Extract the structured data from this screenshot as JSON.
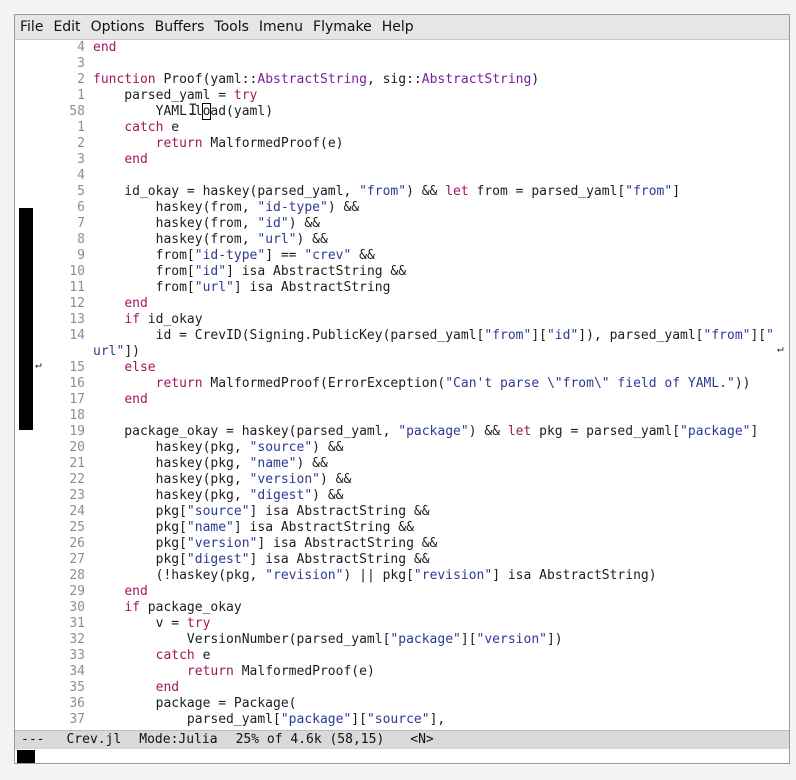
{
  "menu": [
    "File",
    "Edit",
    "Options",
    "Buffers",
    "Tools",
    "Imenu",
    "Flymake",
    "Help"
  ],
  "modeline": {
    "status": "---",
    "buffer": "Crev.jl",
    "mode": "Mode:Julia",
    "position": "25% of 4.6k (58,15)",
    "state": "<N>"
  },
  "icons": {
    "wrap_left": "wrap-left-arrow-icon",
    "wrap_right": "wrap-right-arrow-icon",
    "ibeam": "ibeam-cursor-icon"
  },
  "lines": [
    {
      "n": "4",
      "t": [
        [
          "end",
          "kw"
        ]
      ]
    },
    {
      "n": "3",
      "t": []
    },
    {
      "n": "2",
      "t": [
        [
          "function",
          "kw"
        ],
        [
          " Proof(yaml::",
          ""
        ],
        [
          "AbstractString",
          "ty"
        ],
        [
          ", sig::",
          ""
        ],
        [
          "AbstractString",
          "ty"
        ],
        [
          ")",
          ""
        ]
      ]
    },
    {
      "n": "1",
      "t": [
        [
          "    parsed_yaml = ",
          ""
        ],
        [
          "try",
          "kw"
        ]
      ]
    },
    {
      "n": "58",
      "t": [
        [
          "        YAML.l",
          ""
        ],
        [
          "o",
          "cur"
        ],
        [
          "ad(yaml)",
          ""
        ]
      ]
    },
    {
      "n": "1",
      "t": [
        [
          "    ",
          ""
        ],
        [
          "catch",
          "kw"
        ],
        [
          " e",
          ""
        ]
      ]
    },
    {
      "n": "2",
      "t": [
        [
          "        ",
          ""
        ],
        [
          "return",
          "kw"
        ],
        [
          " MalformedProof(e)",
          ""
        ]
      ]
    },
    {
      "n": "3",
      "t": [
        [
          "    ",
          ""
        ],
        [
          "end",
          "kw"
        ]
      ]
    },
    {
      "n": "4",
      "t": []
    },
    {
      "n": "5",
      "t": [
        [
          "    id_okay = haskey(parsed_yaml, ",
          ""
        ],
        [
          "\"from\"",
          "st"
        ],
        [
          ") && ",
          ""
        ],
        [
          "let",
          "kw"
        ],
        [
          " from = parsed_yaml[",
          ""
        ],
        [
          "\"from\"",
          "st"
        ],
        [
          "]",
          ""
        ]
      ]
    },
    {
      "n": "6",
      "t": [
        [
          "        haskey(from, ",
          ""
        ],
        [
          "\"id-type\"",
          "st"
        ],
        [
          ") &&",
          ""
        ]
      ]
    },
    {
      "n": "7",
      "t": [
        [
          "        haskey(from, ",
          ""
        ],
        [
          "\"id\"",
          "st"
        ],
        [
          ") &&",
          ""
        ]
      ]
    },
    {
      "n": "8",
      "t": [
        [
          "        haskey(from, ",
          ""
        ],
        [
          "\"url\"",
          "st"
        ],
        [
          ") &&",
          ""
        ]
      ]
    },
    {
      "n": "9",
      "t": [
        [
          "        from[",
          ""
        ],
        [
          "\"id-type\"",
          "st"
        ],
        [
          "] == ",
          ""
        ],
        [
          "\"crev\"",
          "st"
        ],
        [
          " &&",
          ""
        ]
      ]
    },
    {
      "n": "10",
      "t": [
        [
          "        from[",
          ""
        ],
        [
          "\"id\"",
          "st"
        ],
        [
          "] isa AbstractString &&",
          ""
        ]
      ]
    },
    {
      "n": "11",
      "t": [
        [
          "        from[",
          ""
        ],
        [
          "\"url\"",
          "st"
        ],
        [
          "] isa AbstractString",
          ""
        ]
      ]
    },
    {
      "n": "12",
      "t": [
        [
          "    ",
          ""
        ],
        [
          "end",
          "kw"
        ]
      ]
    },
    {
      "n": "13",
      "t": [
        [
          "    ",
          ""
        ],
        [
          "if",
          "kw"
        ],
        [
          " id_okay",
          ""
        ]
      ]
    },
    {
      "n": "14",
      "t": [
        [
          "        id = CrevID(Signing.PublicKey(parsed_yaml[",
          ""
        ],
        [
          "\"from\"",
          "st"
        ],
        [
          "][",
          ""
        ],
        [
          "\"id\"",
          "st"
        ],
        [
          "]), parsed_yaml[",
          ""
        ],
        [
          "\"from\"",
          "st"
        ],
        [
          "][",
          ""
        ],
        [
          "\"",
          "st"
        ]
      ]
    },
    {
      "n": "",
      "t": [
        [
          "url\"",
          "st"
        ],
        [
          "])",
          ""
        ]
      ]
    },
    {
      "n": "15",
      "t": [
        [
          "    ",
          ""
        ],
        [
          "else",
          "kw"
        ]
      ]
    },
    {
      "n": "16",
      "t": [
        [
          "        ",
          ""
        ],
        [
          "return",
          "kw"
        ],
        [
          " MalformedProof(ErrorException(",
          ""
        ],
        [
          "\"Can't parse \\\"from\\\" field of YAML.\"",
          "st"
        ],
        [
          "))",
          ""
        ]
      ]
    },
    {
      "n": "17",
      "t": [
        [
          "    ",
          ""
        ],
        [
          "end",
          "kw"
        ]
      ]
    },
    {
      "n": "18",
      "t": []
    },
    {
      "n": "19",
      "t": [
        [
          "    package_okay = haskey(parsed_yaml, ",
          ""
        ],
        [
          "\"package\"",
          "st"
        ],
        [
          ") && ",
          ""
        ],
        [
          "let",
          "kw"
        ],
        [
          " pkg = parsed_yaml[",
          ""
        ],
        [
          "\"package\"",
          "st"
        ],
        [
          "]",
          ""
        ]
      ]
    },
    {
      "n": "20",
      "t": [
        [
          "        haskey(pkg, ",
          ""
        ],
        [
          "\"source\"",
          "st"
        ],
        [
          ") &&",
          ""
        ]
      ]
    },
    {
      "n": "21",
      "t": [
        [
          "        haskey(pkg, ",
          ""
        ],
        [
          "\"name\"",
          "st"
        ],
        [
          ") &&",
          ""
        ]
      ]
    },
    {
      "n": "22",
      "t": [
        [
          "        haskey(pkg, ",
          ""
        ],
        [
          "\"version\"",
          "st"
        ],
        [
          ") &&",
          ""
        ]
      ]
    },
    {
      "n": "23",
      "t": [
        [
          "        haskey(pkg, ",
          ""
        ],
        [
          "\"digest\"",
          "st"
        ],
        [
          ") &&",
          ""
        ]
      ]
    },
    {
      "n": "24",
      "t": [
        [
          "        pkg[",
          ""
        ],
        [
          "\"source\"",
          "st"
        ],
        [
          "] isa AbstractString &&",
          ""
        ]
      ]
    },
    {
      "n": "25",
      "t": [
        [
          "        pkg[",
          ""
        ],
        [
          "\"name\"",
          "st"
        ],
        [
          "] isa AbstractString &&",
          ""
        ]
      ]
    },
    {
      "n": "26",
      "t": [
        [
          "        pkg[",
          ""
        ],
        [
          "\"version\"",
          "st"
        ],
        [
          "] isa AbstractString &&",
          ""
        ]
      ]
    },
    {
      "n": "27",
      "t": [
        [
          "        pkg[",
          ""
        ],
        [
          "\"digest\"",
          "st"
        ],
        [
          "] isa AbstractString &&",
          ""
        ]
      ]
    },
    {
      "n": "28",
      "t": [
        [
          "        (!haskey(pkg, ",
          ""
        ],
        [
          "\"revision\"",
          "st"
        ],
        [
          ") || pkg[",
          ""
        ],
        [
          "\"revision\"",
          "st"
        ],
        [
          "] isa AbstractString)",
          ""
        ]
      ]
    },
    {
      "n": "29",
      "t": [
        [
          "    ",
          ""
        ],
        [
          "end",
          "kw"
        ]
      ]
    },
    {
      "n": "30",
      "t": [
        [
          "    ",
          ""
        ],
        [
          "if",
          "kw"
        ],
        [
          " package_okay",
          ""
        ]
      ]
    },
    {
      "n": "31",
      "t": [
        [
          "        v = ",
          ""
        ],
        [
          "try",
          "kw"
        ]
      ]
    },
    {
      "n": "32",
      "t": [
        [
          "            VersionNumber(parsed_yaml[",
          ""
        ],
        [
          "\"package\"",
          "st"
        ],
        [
          "][",
          ""
        ],
        [
          "\"version\"",
          "st"
        ],
        [
          "])",
          ""
        ]
      ]
    },
    {
      "n": "33",
      "t": [
        [
          "        ",
          ""
        ],
        [
          "catch",
          "kw"
        ],
        [
          " e",
          ""
        ]
      ]
    },
    {
      "n": "34",
      "t": [
        [
          "            ",
          ""
        ],
        [
          "return",
          "kw"
        ],
        [
          " MalformedProof(e)",
          ""
        ]
      ]
    },
    {
      "n": "35",
      "t": [
        [
          "        ",
          ""
        ],
        [
          "end",
          "kw"
        ]
      ]
    },
    {
      "n": "36",
      "t": [
        [
          "        package = Package(",
          ""
        ]
      ]
    },
    {
      "n": "37",
      "t": [
        [
          "            parsed_yaml[",
          ""
        ],
        [
          "\"package\"",
          "st"
        ],
        [
          "][",
          ""
        ],
        [
          "\"source\"",
          "st"
        ],
        [
          "],",
          ""
        ]
      ]
    }
  ]
}
